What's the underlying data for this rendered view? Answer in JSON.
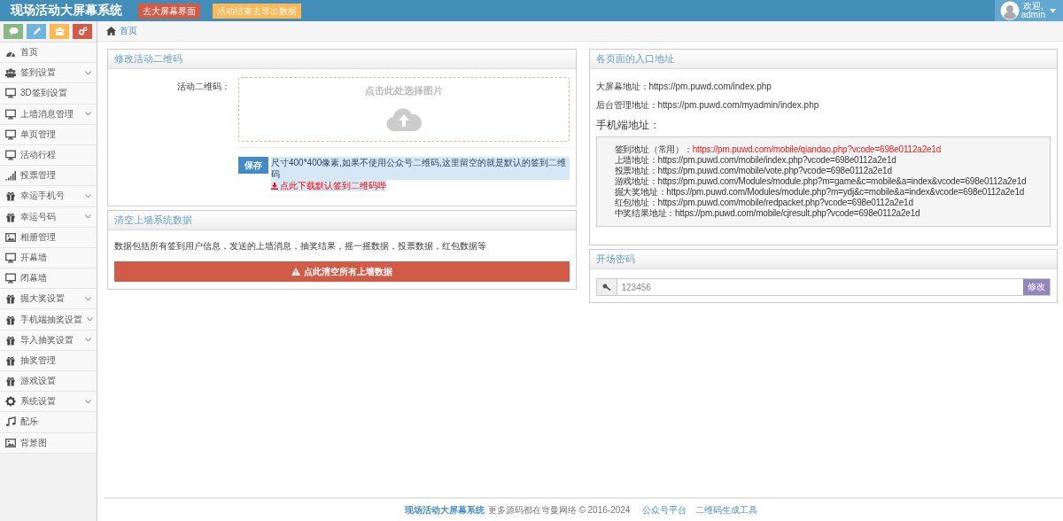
{
  "header": {
    "title": "现场活动大屏幕系统",
    "buttons": [
      {
        "label": "去大屏幕界面",
        "color": "#d15b47"
      },
      {
        "label": "活动结束去导出数据",
        "color": "#ffb752"
      }
    ],
    "user": {
      "greeting": "欢迎,",
      "name": "admin"
    }
  },
  "shortcuts": [
    {
      "kind": "comment",
      "color": "#87b87f"
    },
    {
      "kind": "pencil",
      "color": "#6fb3e0"
    },
    {
      "kind": "users",
      "color": "#ffb752"
    },
    {
      "kind": "cogs",
      "color": "#d15b47"
    }
  ],
  "sidebar": {
    "items": [
      {
        "label": "首页",
        "kind": "dashboard",
        "submenu": false
      },
      {
        "label": "签到设置",
        "kind": "users",
        "submenu": true
      },
      {
        "label": "3D签到设置",
        "kind": "desktop",
        "submenu": false
      },
      {
        "label": "上墙消息管理",
        "kind": "desktop",
        "submenu": true
      },
      {
        "label": "单页管理",
        "kind": "desktop",
        "submenu": false
      },
      {
        "label": "活动行程",
        "kind": "desktop",
        "submenu": false
      },
      {
        "label": "投票管理",
        "kind": "signal",
        "submenu": false
      },
      {
        "label": "幸运手机号",
        "kind": "gift",
        "submenu": true
      },
      {
        "label": "幸运号码",
        "kind": "gift",
        "submenu": true
      },
      {
        "label": "相册管理",
        "kind": "picture",
        "submenu": false
      },
      {
        "label": "开幕墙",
        "kind": "desktop",
        "submenu": false
      },
      {
        "label": "闭幕墙",
        "kind": "desktop",
        "submenu": false
      },
      {
        "label": "掘大奖设置",
        "kind": "gift",
        "submenu": true
      },
      {
        "label": "手机端抽奖设置",
        "kind": "gift",
        "submenu": true
      },
      {
        "label": "导入抽奖设置",
        "kind": "gift",
        "submenu": true
      },
      {
        "label": "抽奖管理",
        "kind": "gift",
        "submenu": false
      },
      {
        "label": "游戏设置",
        "kind": "gift",
        "submenu": false
      },
      {
        "label": "系统设置",
        "kind": "cog",
        "submenu": true
      },
      {
        "label": "配乐",
        "kind": "music",
        "submenu": false
      },
      {
        "label": "背景图",
        "kind": "picture",
        "submenu": false
      }
    ]
  },
  "breadcrumb": "首页",
  "qrcode_panel": {
    "title": "修改活动二维码",
    "label": "活动二维码：",
    "dropzone": "点击此处选择图片",
    "save": "保存",
    "help": "尺寸400*400像素,如果不使用公众号二维码,这里留空的就是默认的签到二维码",
    "download_link": "点此下载默认签到二维码哔"
  },
  "clear_panel": {
    "title": "清空上墙系统数据",
    "description": "数据包括所有签到用户信息，发送的上墙消息，抽奖结果，摇一摇数据，投票数据，红包数据等",
    "button": "点此清空所有上墙数据"
  },
  "entry_panel": {
    "title": "各页面的入口地址",
    "addresses": [
      {
        "label": "大屏幕地址：",
        "url": "https://pm.puwd.com/index.php"
      },
      {
        "label": "后台管理地址：",
        "url": "https://pm.puwd.com/myadmin/index.php"
      }
    ],
    "mobile_heading": "手机端地址：",
    "mobile": [
      {
        "label": "签到地址（常用）：",
        "url": "https://pm.puwd.com/mobile/qiandao.php?vcode=698e0112a2e1d",
        "highlighted": true
      },
      {
        "label": "上墙地址：",
        "url": "https://pm.puwd.com/mobile/index.php?vcode=698e0112a2e1d",
        "highlighted": false
      },
      {
        "label": "投票地址：",
        "url": "https://pm.puwd.com/mobile/vote.php?vcode=698e0112a2e1d",
        "highlighted": false
      },
      {
        "label": "游戏地址：",
        "url": "https://pm.puwd.com/Modules/module.php?m=game&c=mobile&a=index&vcode=698e0112a2e1d",
        "highlighted": false
      },
      {
        "label": "掘大奖地址：",
        "url": "https://pm.puwd.com/Modules/module.php?m=ydj&c=mobile&a=index&vcode=698e0112a2e1d",
        "highlighted": false
      },
      {
        "label": "红包地址：",
        "url": "https://pm.puwd.com/mobile/redpacket.php?vcode=698e0112a2e1d",
        "highlighted": false
      },
      {
        "label": "中奖结果地址：",
        "url": "https://pm.puwd.com/mobile/cjresult.php?vcode=698e0112a2e1d",
        "highlighted": false
      }
    ]
  },
  "password_panel": {
    "title": "开场密码",
    "value": "123456",
    "button": "修改"
  },
  "footer": {
    "brand": "现场活动大屏幕系统",
    "text": "更多源码都在穹曼网络 © 2016-2024",
    "links": [
      "公众号平台",
      "二维码生成工具"
    ]
  }
}
